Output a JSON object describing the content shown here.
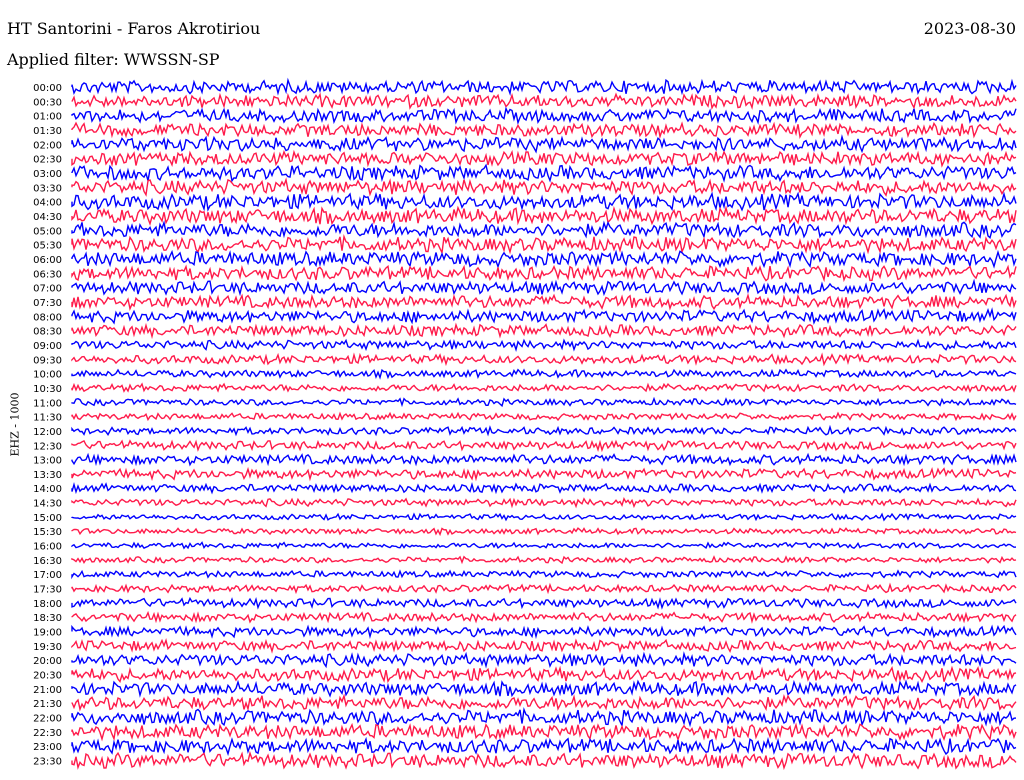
{
  "header": {
    "station": "HT Santorini - Faros Akrotiriou",
    "date": "2023-08-30",
    "filter": "Applied filter: WWSSN-SP",
    "channel": "EHZ - 1000"
  },
  "colors": {
    "trace_a": "#0000ff",
    "trace_b": "#ff1a4a",
    "background": "#ffffff"
  },
  "chart_data": {
    "type": "line",
    "title": "HT Santorini - Faros Akrotiriou",
    "subtitle": "Applied filter: WWSSN-SP",
    "ylabel": "EHZ - 1000",
    "xlabel": "",
    "grid": false,
    "legend": "none",
    "ytick_labels": [
      "00:00",
      "00:30",
      "01:00",
      "01:30",
      "02:00",
      "02:30",
      "03:00",
      "03:30",
      "04:00",
      "04:30",
      "05:00",
      "05:30",
      "06:00",
      "06:30",
      "07:00",
      "07:30",
      "08:00",
      "08:30",
      "09:00",
      "09:30",
      "10:00",
      "10:30",
      "11:00",
      "11:30",
      "12:00",
      "12:30",
      "13:00",
      "13:30",
      "14:00",
      "14:30",
      "15:00",
      "15:30",
      "16:00",
      "16:30",
      "17:00",
      "17:30",
      "18:00",
      "18:30",
      "19:00",
      "19:30",
      "20:00",
      "20:30",
      "21:00",
      "21:30",
      "22:00",
      "22:30",
      "23:00",
      "23:30"
    ],
    "series": [
      {
        "color": "#0000ff",
        "rows": [
          0,
          2,
          4,
          6,
          8,
          10,
          12,
          14,
          16,
          18,
          20,
          22,
          24,
          26,
          28,
          30,
          32,
          34,
          36,
          38,
          40,
          42,
          44,
          46
        ]
      },
      {
        "color": "#ff1a4a",
        "rows": [
          1,
          3,
          5,
          7,
          9,
          11,
          13,
          15,
          17,
          19,
          21,
          23,
          25,
          27,
          29,
          31,
          33,
          35,
          37,
          39,
          41,
          43,
          45,
          47
        ]
      }
    ],
    "amplitude_levels": [
      0.8,
      0.8,
      0.8,
      0.8,
      0.85,
      0.85,
      0.9,
      0.9,
      0.95,
      0.95,
      0.9,
      0.9,
      0.9,
      0.85,
      0.8,
      0.8,
      0.75,
      0.7,
      0.55,
      0.55,
      0.45,
      0.45,
      0.4,
      0.4,
      0.45,
      0.55,
      0.6,
      0.6,
      0.5,
      0.45,
      0.35,
      0.35,
      0.35,
      0.35,
      0.4,
      0.45,
      0.55,
      0.55,
      0.6,
      0.65,
      0.75,
      0.8,
      0.85,
      0.85,
      0.9,
      0.9,
      0.9,
      0.9
    ]
  }
}
